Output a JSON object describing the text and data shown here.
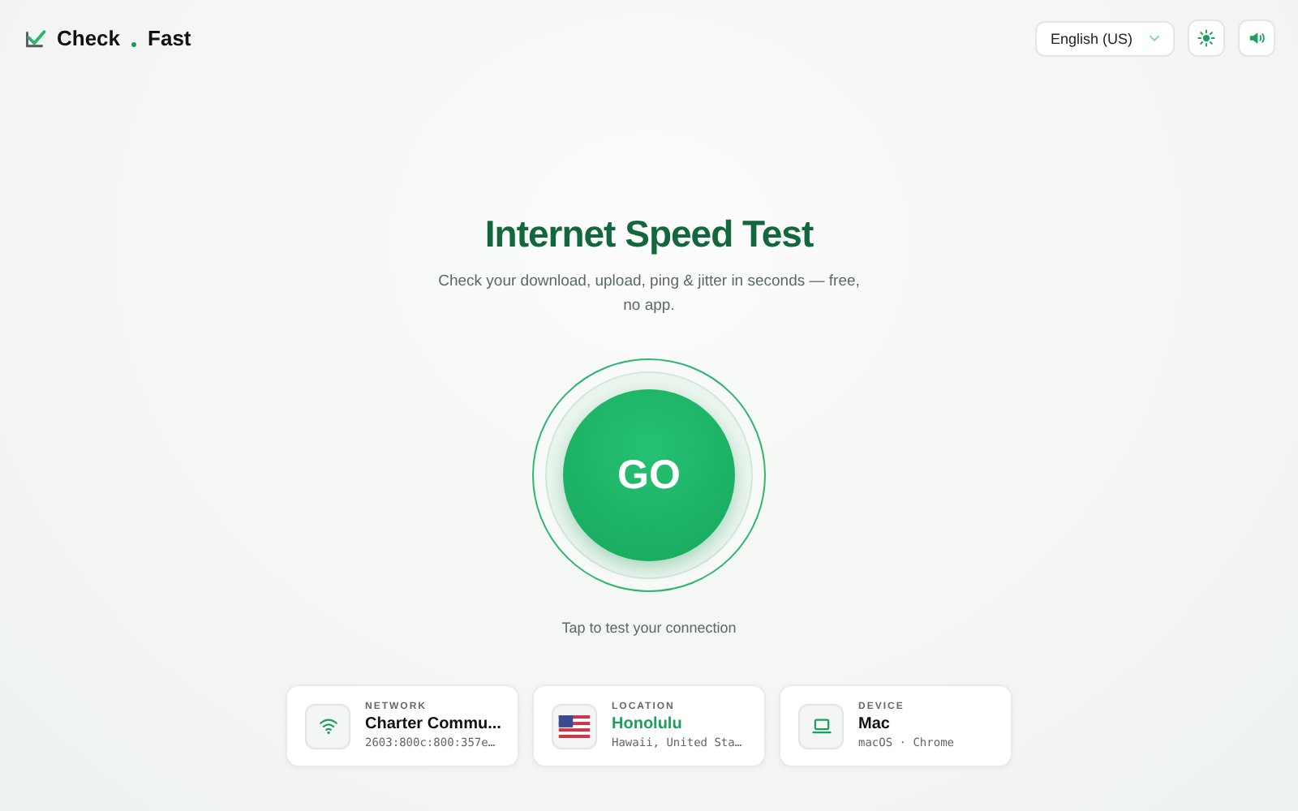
{
  "logo": {
    "first": "Check",
    "second": "Fast"
  },
  "language": {
    "value": "English (US)"
  },
  "hero": {
    "title": "Internet Speed Test",
    "subtitle": "Check your download, upload, ping & jitter in seconds — free, no app.",
    "button": "GO",
    "hint": "Tap to test your connection"
  },
  "cards": [
    {
      "kind": "network",
      "label": "NETWORK",
      "value": "Charter Commu...",
      "detail": "2603:800c:800:357e…",
      "accent": false
    },
    {
      "kind": "location",
      "label": "LOCATION",
      "value": "Honolulu",
      "detail": "Hawaii, United Sta…",
      "accent": true
    },
    {
      "kind": "device",
      "label": "DEVICE",
      "value": "Mac",
      "detail": "macOS · Chrome",
      "accent": false
    }
  ]
}
